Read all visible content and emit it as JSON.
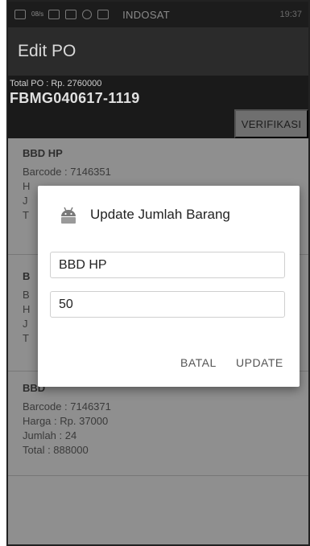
{
  "status_bar": {
    "left_text": "08/s",
    "carrier": "INDOSAT",
    "right_text": "19:37"
  },
  "app_bar": {
    "title": "Edit PO"
  },
  "po": {
    "total_label": "Total PO : Rp. 2760000",
    "code": "FBMG040617-1119",
    "verify_label": "VERIFIKASI"
  },
  "items": [
    {
      "name": "BBD HP",
      "barcode": "Barcode : 7146351",
      "harga": "H",
      "jumlah": "J",
      "total": "T"
    },
    {
      "name": "B",
      "barcode": "B",
      "harga": "H",
      "jumlah": "J",
      "total": "T"
    },
    {
      "name": "BBD",
      "barcode": "Barcode : 7146371",
      "harga": "Harga : Rp. 37000",
      "jumlah": "Jumlah : 24",
      "total": "Total : 888000"
    }
  ],
  "dialog": {
    "title": "Update Jumlah Barang",
    "name_value": "BBD HP",
    "qty_value": "50",
    "cancel_label": "BATAL",
    "update_label": "UPDATE"
  }
}
